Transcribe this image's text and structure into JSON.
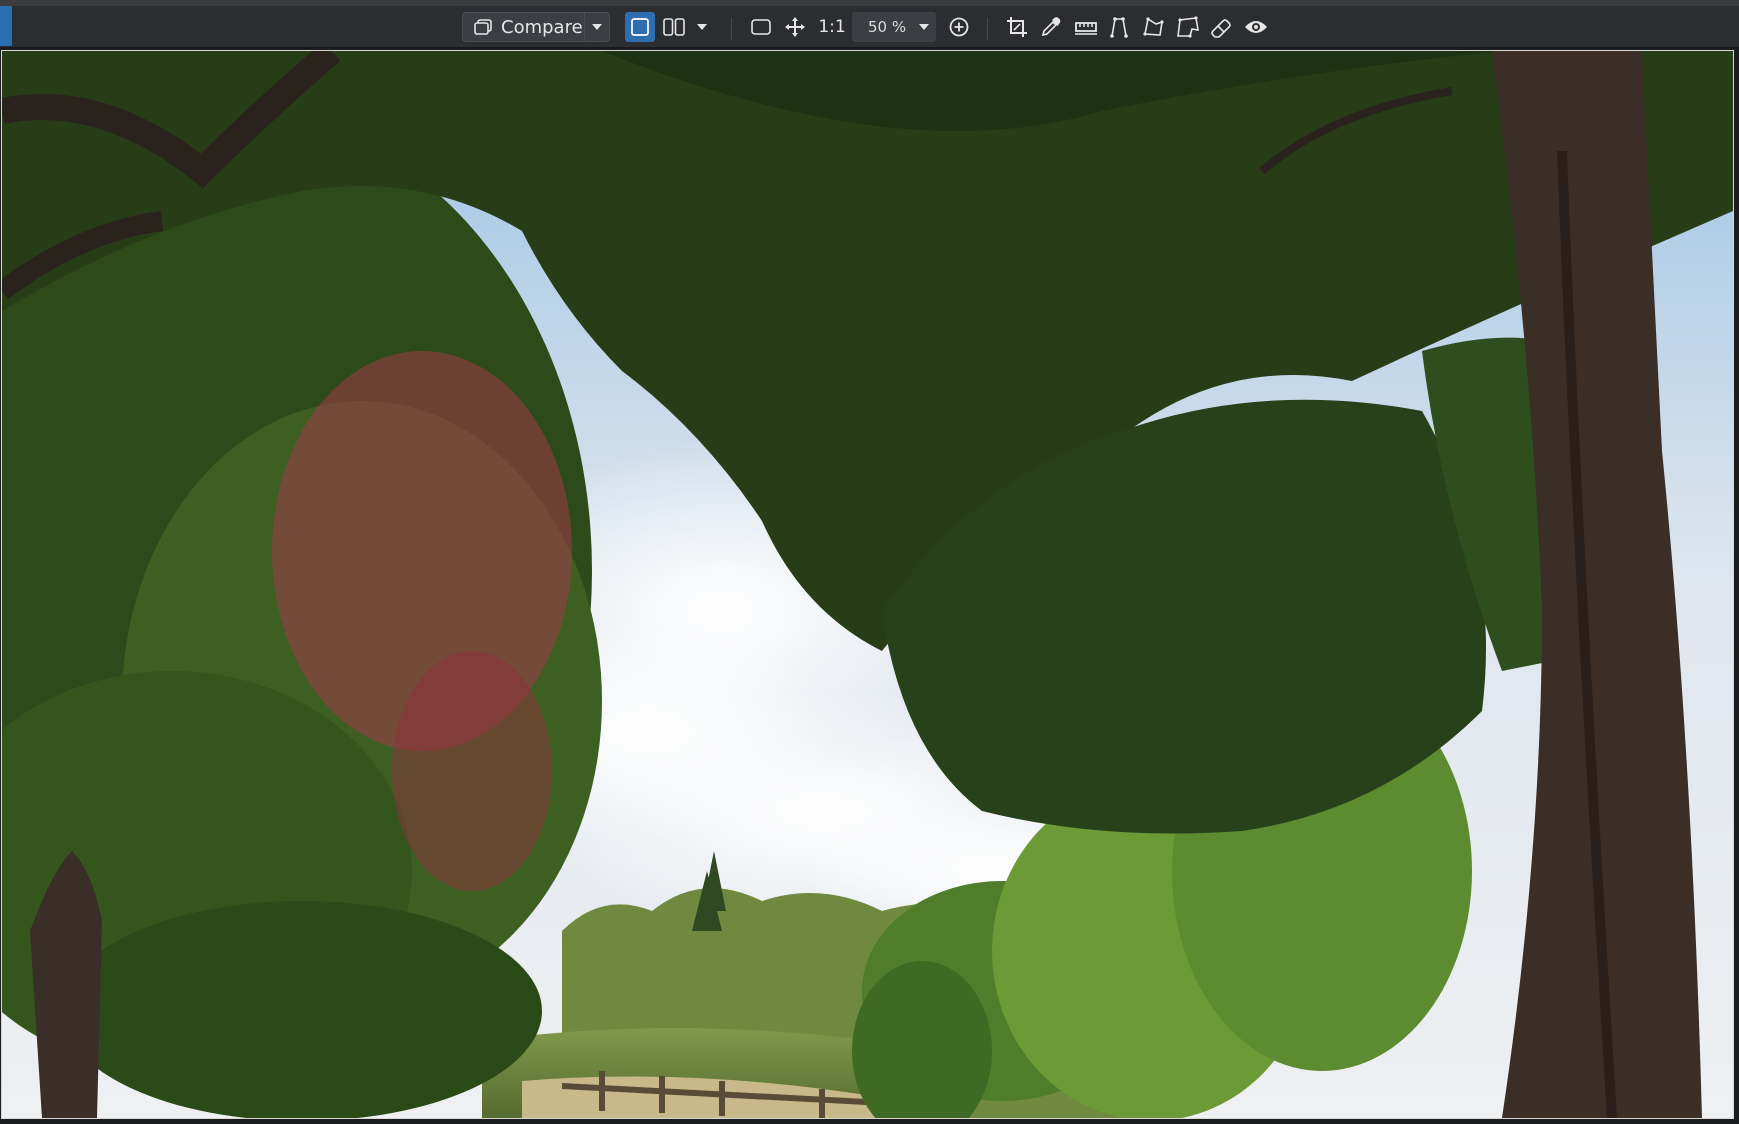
{
  "toolbar": {
    "compare_label": "Compare",
    "one_to_one_label": "1:1",
    "zoom_value": "50 %"
  },
  "icons": {
    "compare": "compare-icon",
    "dropdown": "chevron-down-icon",
    "single_view": "single-view-icon",
    "split_view": "split-view-icon",
    "fit": "fit-to-screen-icon",
    "pan": "pan-move-icon",
    "zoom_in": "zoom-in-icon",
    "crop": "crop-icon",
    "color_picker": "eyedropper-icon",
    "straighten": "straighten-icon",
    "lasso": "lasso-icon",
    "polygon": "polygon-lasso-icon",
    "polygon_alt": "magnetic-lasso-icon",
    "eraser": "eraser-icon",
    "preview": "eye-icon"
  },
  "colors": {
    "toolbar_bg": "#2b2d31",
    "accent": "#2e6db0",
    "text": "#e6e6e6"
  }
}
